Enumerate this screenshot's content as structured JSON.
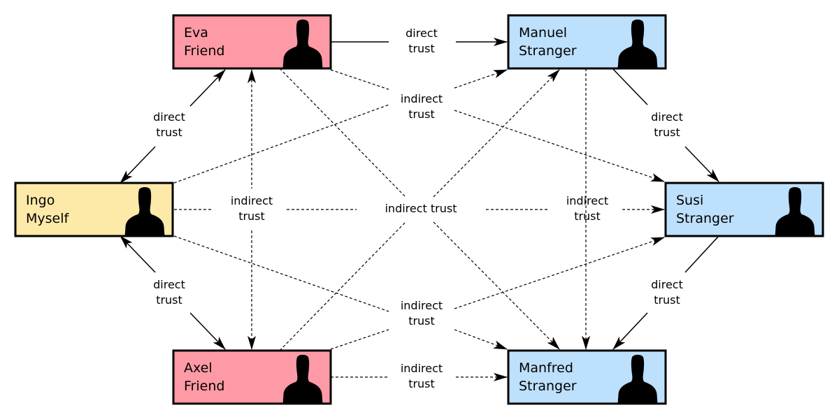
{
  "colors": {
    "friend": "#fe9aa6",
    "myself": "#fde9a8",
    "stranger": "#bde0fd",
    "line": "#000000"
  },
  "nodes": [
    {
      "id": "eva",
      "name": "Eva",
      "role": "Friend",
      "kind": "friend"
    },
    {
      "id": "manuel",
      "name": "Manuel",
      "role": "Stranger",
      "kind": "stranger"
    },
    {
      "id": "ingo",
      "name": "Ingo",
      "role": "Myself",
      "kind": "myself"
    },
    {
      "id": "susi",
      "name": "Susi",
      "role": "Stranger",
      "kind": "stranger"
    },
    {
      "id": "axel",
      "name": "Axel",
      "role": "Friend",
      "kind": "friend"
    },
    {
      "id": "manfred",
      "name": "Manfred",
      "role": "Stranger",
      "kind": "stranger"
    }
  ],
  "labels": {
    "direct": [
      "direct",
      "trust"
    ],
    "indirect": [
      "indirect",
      "trust"
    ],
    "indirect_single": "indirect trust"
  },
  "edges": [
    {
      "from": "ingo",
      "to": "eva",
      "type": "direct",
      "bidirectional": true
    },
    {
      "from": "ingo",
      "to": "axel",
      "type": "direct",
      "bidirectional": true
    },
    {
      "from": "eva",
      "to": "manuel",
      "type": "direct"
    },
    {
      "from": "manuel",
      "to": "susi",
      "type": "direct"
    },
    {
      "from": "susi",
      "to": "manfred",
      "type": "direct"
    },
    {
      "from": "axel",
      "to": "manfred",
      "type": "indirect"
    },
    {
      "from": "ingo",
      "to": "susi",
      "type": "indirect"
    },
    {
      "from": "eva",
      "to": "axel",
      "type": "indirect",
      "bidirectional": true
    },
    {
      "from": "ingo",
      "to": "manuel",
      "type": "indirect"
    },
    {
      "from": "eva",
      "to": "susi",
      "type": "indirect"
    },
    {
      "from": "ingo",
      "to": "manfred",
      "type": "indirect"
    },
    {
      "from": "axel",
      "to": "susi",
      "type": "indirect"
    },
    {
      "from": "eva",
      "to": "manfred",
      "type": "indirect"
    },
    {
      "from": "axel",
      "to": "manuel",
      "type": "indirect"
    },
    {
      "from": "manuel",
      "to": "manfred",
      "type": "indirect"
    }
  ]
}
